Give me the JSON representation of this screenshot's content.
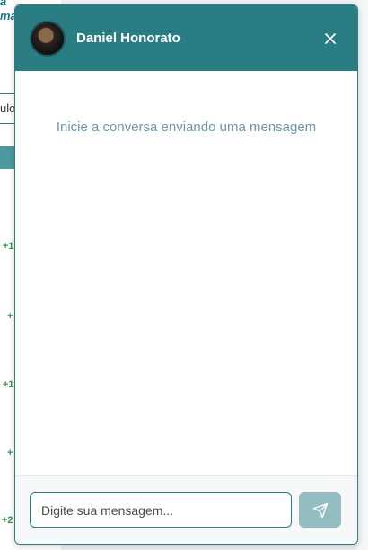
{
  "background": {
    "italic_lines": [
      "a",
      "ma"
    ],
    "tab_label": "ulo",
    "numbers": [
      "+1",
      "+",
      "+1",
      "+",
      "+2"
    ]
  },
  "chat": {
    "contact_name": "Daniel Honorato",
    "avatar_icon": "avatar-photo",
    "close_icon": "close-icon",
    "empty_message": "Inicie a conversa enviando uma mensagem",
    "input_placeholder": "Digite sua mensagem...",
    "input_value": "",
    "send_icon": "send-icon",
    "colors": {
      "header": "#2a7d83",
      "send_button": "#94bcc3",
      "empty_text": "#6c97a7"
    }
  }
}
